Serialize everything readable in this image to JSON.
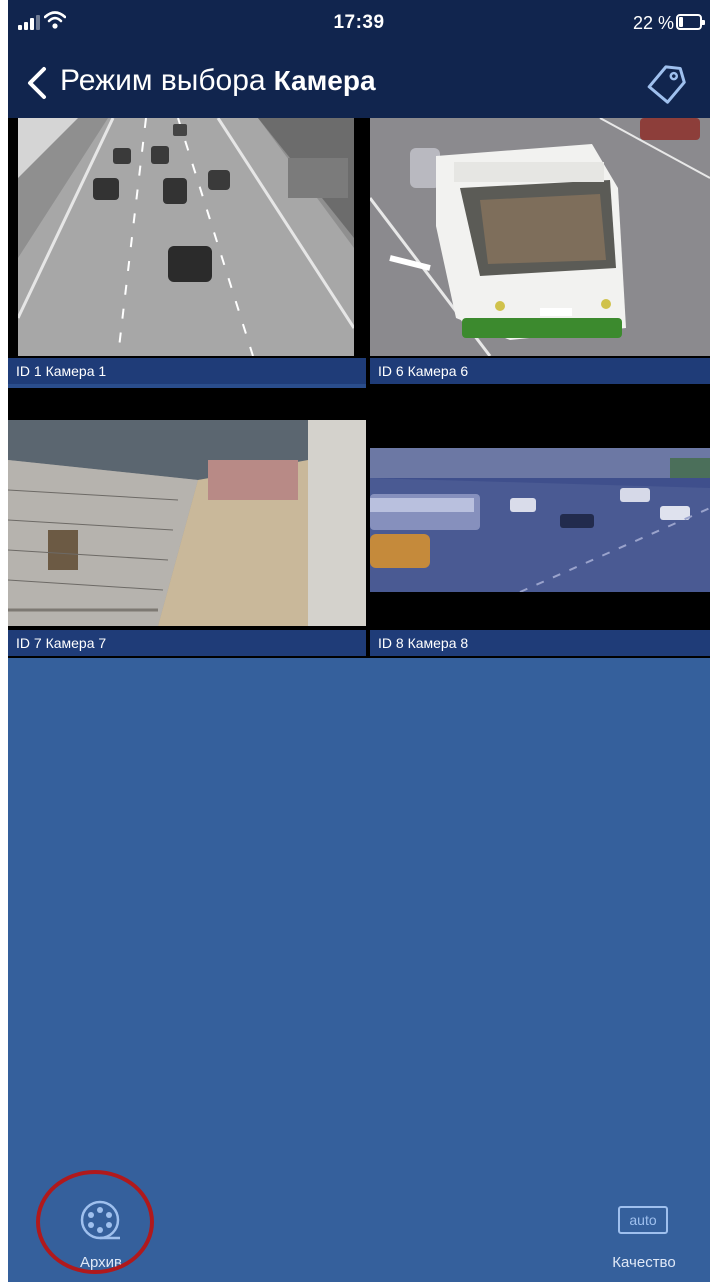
{
  "status_bar": {
    "time": "17:39",
    "battery_text": "22 %",
    "battery_level": 0.22
  },
  "header": {
    "back_icon": "chevron-left-icon",
    "title": "Режим выбора",
    "subtitle": "Камера",
    "action_icon": "tag-icon"
  },
  "cameras": [
    {
      "label": "ID 1 Камера  1"
    },
    {
      "label": "ID 6 Камера 6"
    },
    {
      "label": "ID 7 Камера 7"
    },
    {
      "label": "ID 8 Камера 8"
    }
  ],
  "toolbar": {
    "archive_label": "Архив",
    "archive_icon": "film-reel-icon",
    "quality_badge": "auto",
    "quality_label": "Качество"
  },
  "colors": {
    "background": "#35609c",
    "header": "#11254e",
    "label_bar": "#1f3c78",
    "highlight": "#b0191c"
  }
}
